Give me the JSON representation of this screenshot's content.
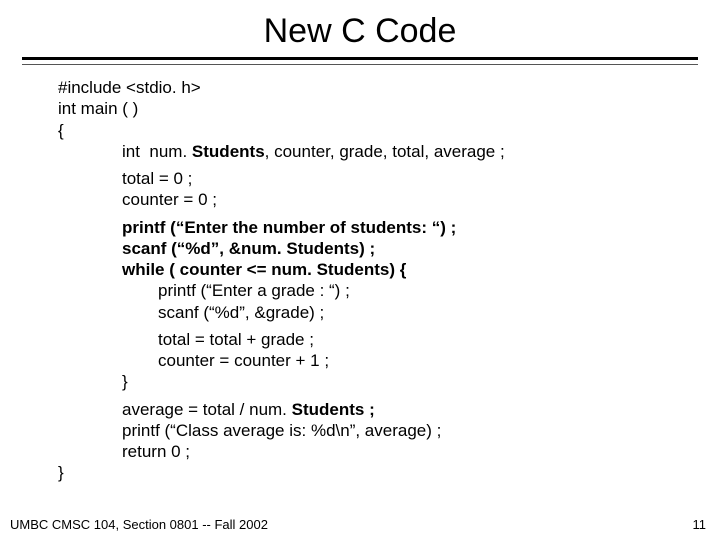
{
  "title": "New C Code",
  "code": {
    "inc": "#include <stdio. h>",
    "main": "int main ( )",
    "ob": "{",
    "decl_a": "int  num. ",
    "decl_b": "Students",
    "decl_c": ", counter, grade, total, average ;",
    "init1": "total = 0 ;",
    "init2": "counter = 0 ;",
    "p1a": "printf (“Enter the number of students: “) ;",
    "s1a": "scanf (“%d”, &num. ",
    "s1b": "Students) ;",
    "w1a": "while ( counter <= num. ",
    "w1b": "Students) {",
    "p2": "printf (“Enter a grade : “) ;",
    "s2": "scanf (“%d”, &grade) ;",
    "t1": "total = total + grade ;",
    "c1": "counter = counter + 1 ;",
    "cb1": "}",
    "avg_a": "average = total / num. ",
    "avg_b": "Students ;",
    "p3": "printf (“Class average is: %d\\n”, average) ;",
    "ret": "return 0 ;",
    "cb2": "}"
  },
  "footer": "UMBC CMSC 104, Section 0801 -- Fall 2002",
  "page": "11"
}
